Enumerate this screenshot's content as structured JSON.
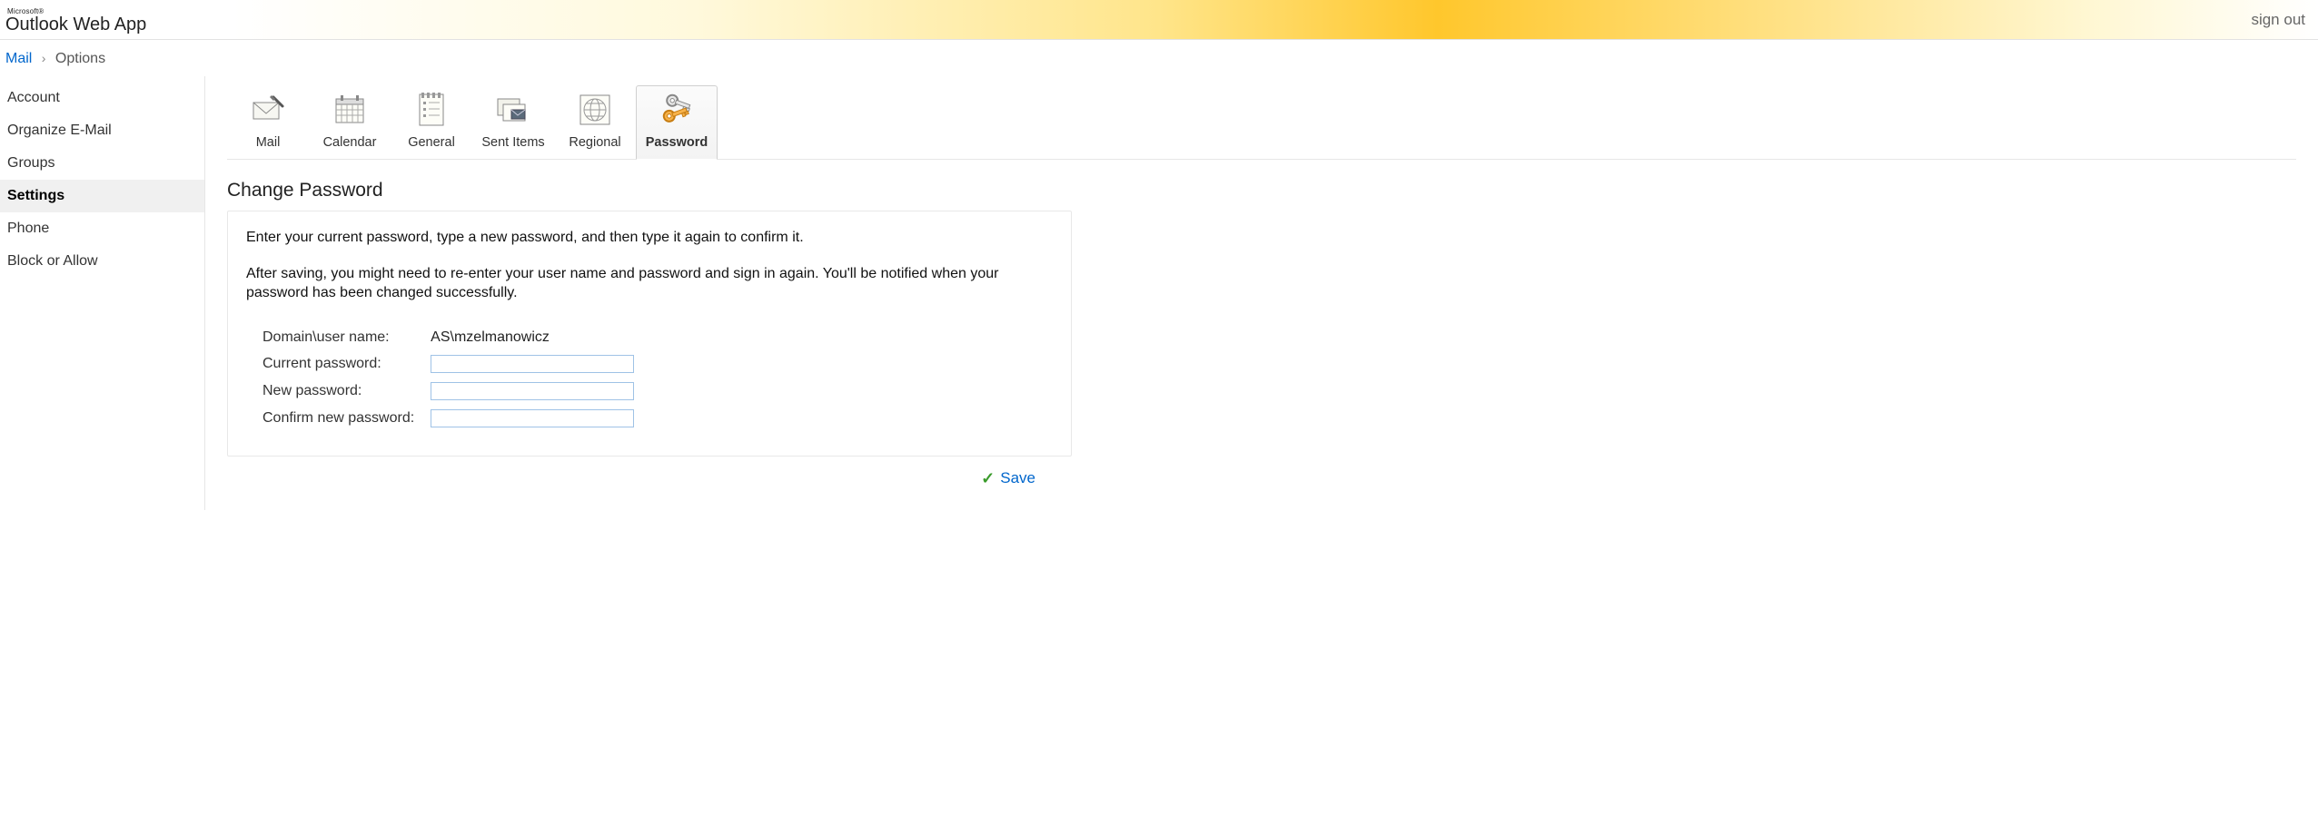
{
  "header": {
    "microsoft": "Microsoft®",
    "app_name_outlook": "Outlook",
    "app_name_rest": " Web App",
    "signout": "sign out"
  },
  "breadcrumb": {
    "root": "Mail",
    "separator": "›",
    "current": "Options"
  },
  "sidebar": {
    "items": [
      {
        "label": "Account",
        "active": false,
        "key": "account"
      },
      {
        "label": "Organize E-Mail",
        "active": false,
        "key": "organize-email"
      },
      {
        "label": "Groups",
        "active": false,
        "key": "groups"
      },
      {
        "label": "Settings",
        "active": true,
        "key": "settings"
      },
      {
        "label": "Phone",
        "active": false,
        "key": "phone"
      },
      {
        "label": "Block or Allow",
        "active": false,
        "key": "block-or-allow"
      }
    ]
  },
  "tabs": {
    "items": [
      {
        "label": "Mail",
        "key": "mail",
        "active": false
      },
      {
        "label": "Calendar",
        "key": "calendar",
        "active": false
      },
      {
        "label": "General",
        "key": "general",
        "active": false
      },
      {
        "label": "Sent Items",
        "key": "sentitems",
        "active": false
      },
      {
        "label": "Regional",
        "key": "regional",
        "active": false
      },
      {
        "label": "Password",
        "key": "password",
        "active": true
      }
    ]
  },
  "section": {
    "title": "Change Password",
    "intro1": "Enter your current password, type a new password, and then type it again to confirm it.",
    "intro2": "After saving, you might need to re-enter your user name and password and sign in again. You'll be notified when your password has been changed successfully.",
    "fields": {
      "domain_user_label": "Domain\\user name:",
      "domain_user_value": "AS\\mzelmanowicz",
      "current_label": "Current password:",
      "new_label": "New password:",
      "confirm_label": "Confirm new password:",
      "current_value": "",
      "new_value": "",
      "confirm_value": ""
    }
  },
  "footer": {
    "save_label": "Save"
  }
}
